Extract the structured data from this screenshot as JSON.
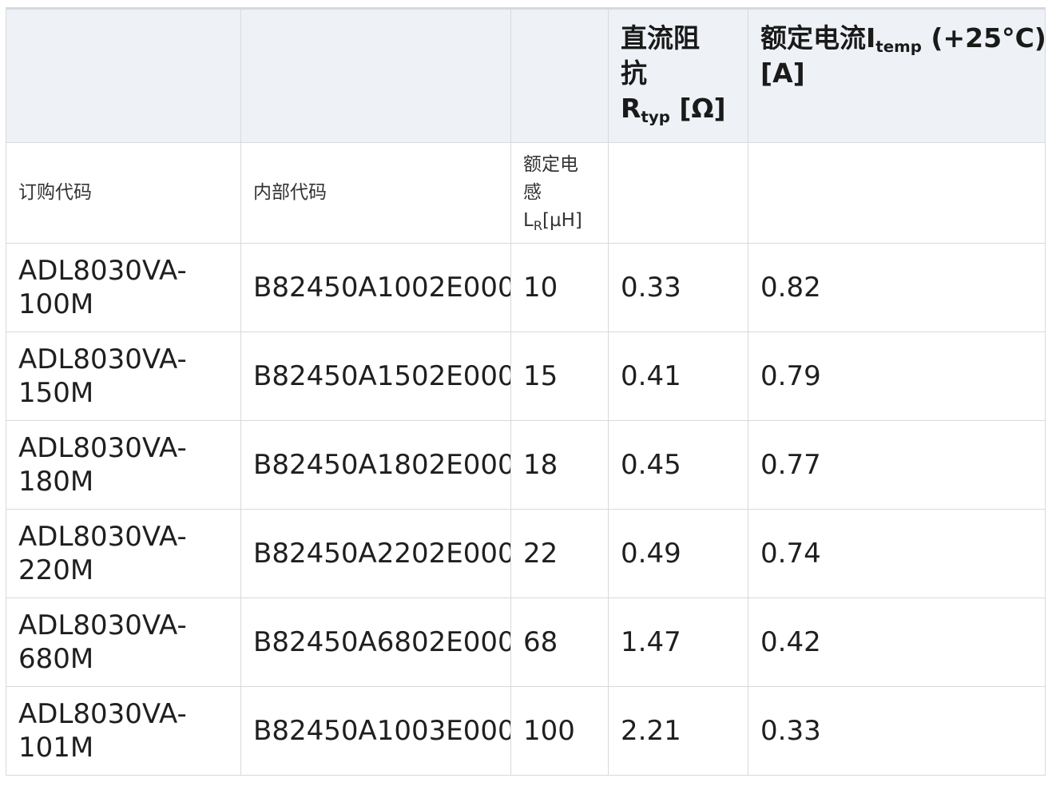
{
  "top_header": {
    "col1": "",
    "col2": "",
    "col3": "",
    "col4_line1": "直流阻",
    "col4_line2": "抗",
    "col4_symbol": "R",
    "col4_subscript": "typ",
    "col4_unit": " [Ω]",
    "col5_prefix": "额定电流I",
    "col5_subscript": "temp",
    "col5_suffix": " (+25°C)",
    "col5_unit": "[A]"
  },
  "sub_header": {
    "order_code": "订购代码",
    "internal_code": "内部代码",
    "inductance_line1": "额定电",
    "inductance_line2": "感",
    "inductance_symbol": "L",
    "inductance_subscript": "R",
    "inductance_unit": "[µH]",
    "col4": "",
    "col5": ""
  },
  "rows": [
    {
      "order_code_line1": "ADL8030VA-",
      "order_code_line2": "100M",
      "internal_code": "B82450A1002E000",
      "inductance": "10",
      "resistance": "0.33",
      "current": "0.82"
    },
    {
      "order_code_line1": "ADL8030VA-",
      "order_code_line2": "150M",
      "internal_code": "B82450A1502E000",
      "inductance": "15",
      "resistance": "0.41",
      "current": "0.79"
    },
    {
      "order_code_line1": "ADL8030VA-",
      "order_code_line2": "180M",
      "internal_code": "B82450A1802E000",
      "inductance": "18",
      "resistance": "0.45",
      "current": "0.77"
    },
    {
      "order_code_line1": "ADL8030VA-",
      "order_code_line2": "220M",
      "internal_code": "B82450A2202E000",
      "inductance": "22",
      "resistance": "0.49",
      "current": "0.74"
    },
    {
      "order_code_line1": "ADL8030VA-",
      "order_code_line2": "680M",
      "internal_code": "B82450A6802E000",
      "inductance": "68",
      "resistance": "1.47",
      "current": "0.42"
    },
    {
      "order_code_line1": "ADL8030VA-",
      "order_code_line2": "101M",
      "internal_code": "B82450A1003E000",
      "inductance": "100",
      "resistance": "2.21",
      "current": "0.33"
    }
  ]
}
